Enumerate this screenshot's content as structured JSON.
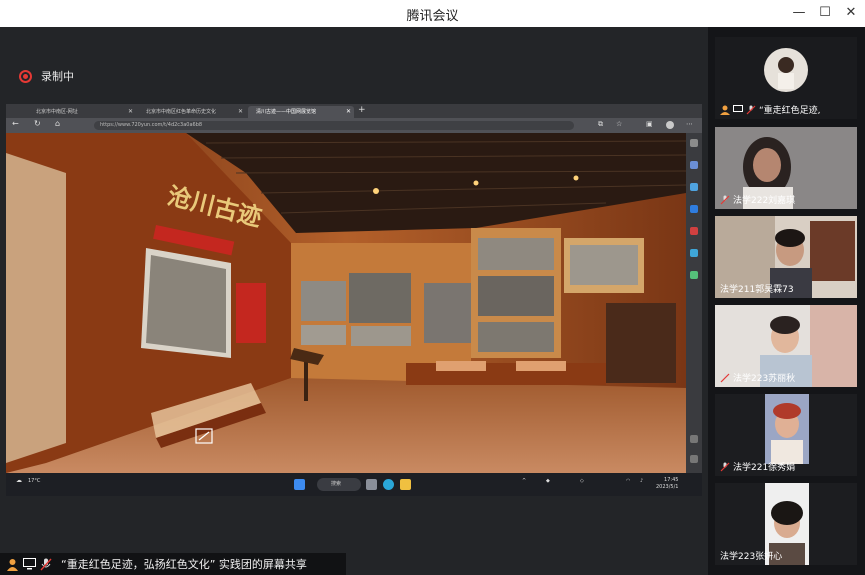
{
  "window": {
    "title": "腾讯会议",
    "controls": [
      "—",
      "☐",
      "✕"
    ]
  },
  "recording": {
    "label": "录制中",
    "color": "#e53935"
  },
  "browser": {
    "tabs": [
      {
        "label": "北京市中南区-网址",
        "active": false
      },
      {
        "label": "北京市中南区红色革命历史文化",
        "active": false
      },
      {
        "label": "清川古迹——中国网展览馆",
        "active": true
      }
    ],
    "url": "https://www.720yun.com/t/4d2c3a0a6b8",
    "hall_sign": "沧川古迹"
  },
  "taskbar": {
    "weather": "17°C",
    "search_label": "搜索",
    "time": "17:45",
    "date": "2023/5/1"
  },
  "share_bar": {
    "text": "“重走红色足迹，弘扬红色文化” 实践团的屏幕共享"
  },
  "participants": [
    {
      "name": "“重走红色足迹,",
      "kind": "avatar"
    },
    {
      "name": "法学222刘嘉琪",
      "kind": "video"
    },
    {
      "name": "法学211郭昊霖73",
      "kind": "video"
    },
    {
      "name": "法学223苏丽秋",
      "kind": "video"
    },
    {
      "name": "法学221徐秀娟",
      "kind": "video"
    },
    {
      "name": "法学223张妍心",
      "kind": "video"
    }
  ]
}
